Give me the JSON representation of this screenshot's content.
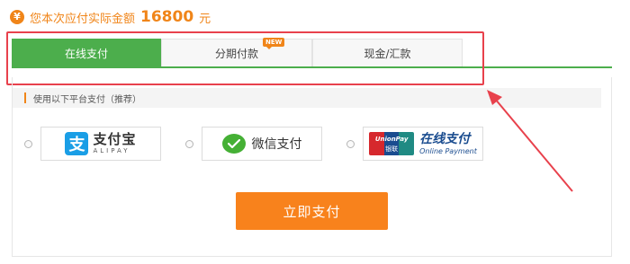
{
  "amount": {
    "icon": "yen-icon",
    "icon_glyph": "¥",
    "label": "您本次应付实际金额",
    "value": "16800",
    "unit": "元"
  },
  "tabs": [
    {
      "label": "在线支付",
      "active": true
    },
    {
      "label": "分期付款",
      "active": false,
      "badge": "NEW"
    },
    {
      "label": "现金/汇款",
      "active": false
    }
  ],
  "panel": {
    "platform_label": "使用以下平台支付（推荐）"
  },
  "payment_options": {
    "alipay": {
      "logo_glyph": "支",
      "name": "支付宝",
      "sub": "ALIPAY"
    },
    "wechat": {
      "name": "微信支付"
    },
    "unionpay": {
      "logo_word": "UnionPay",
      "logo_cn": "银联",
      "name": "在线支付",
      "sub": "Online Payment"
    }
  },
  "pay_button": {
    "label": "立即支付"
  },
  "colors": {
    "accent_orange": "#f08519",
    "tab_green": "#4cae4c",
    "highlight_red": "#e8414c",
    "button_orange": "#f8821c"
  }
}
